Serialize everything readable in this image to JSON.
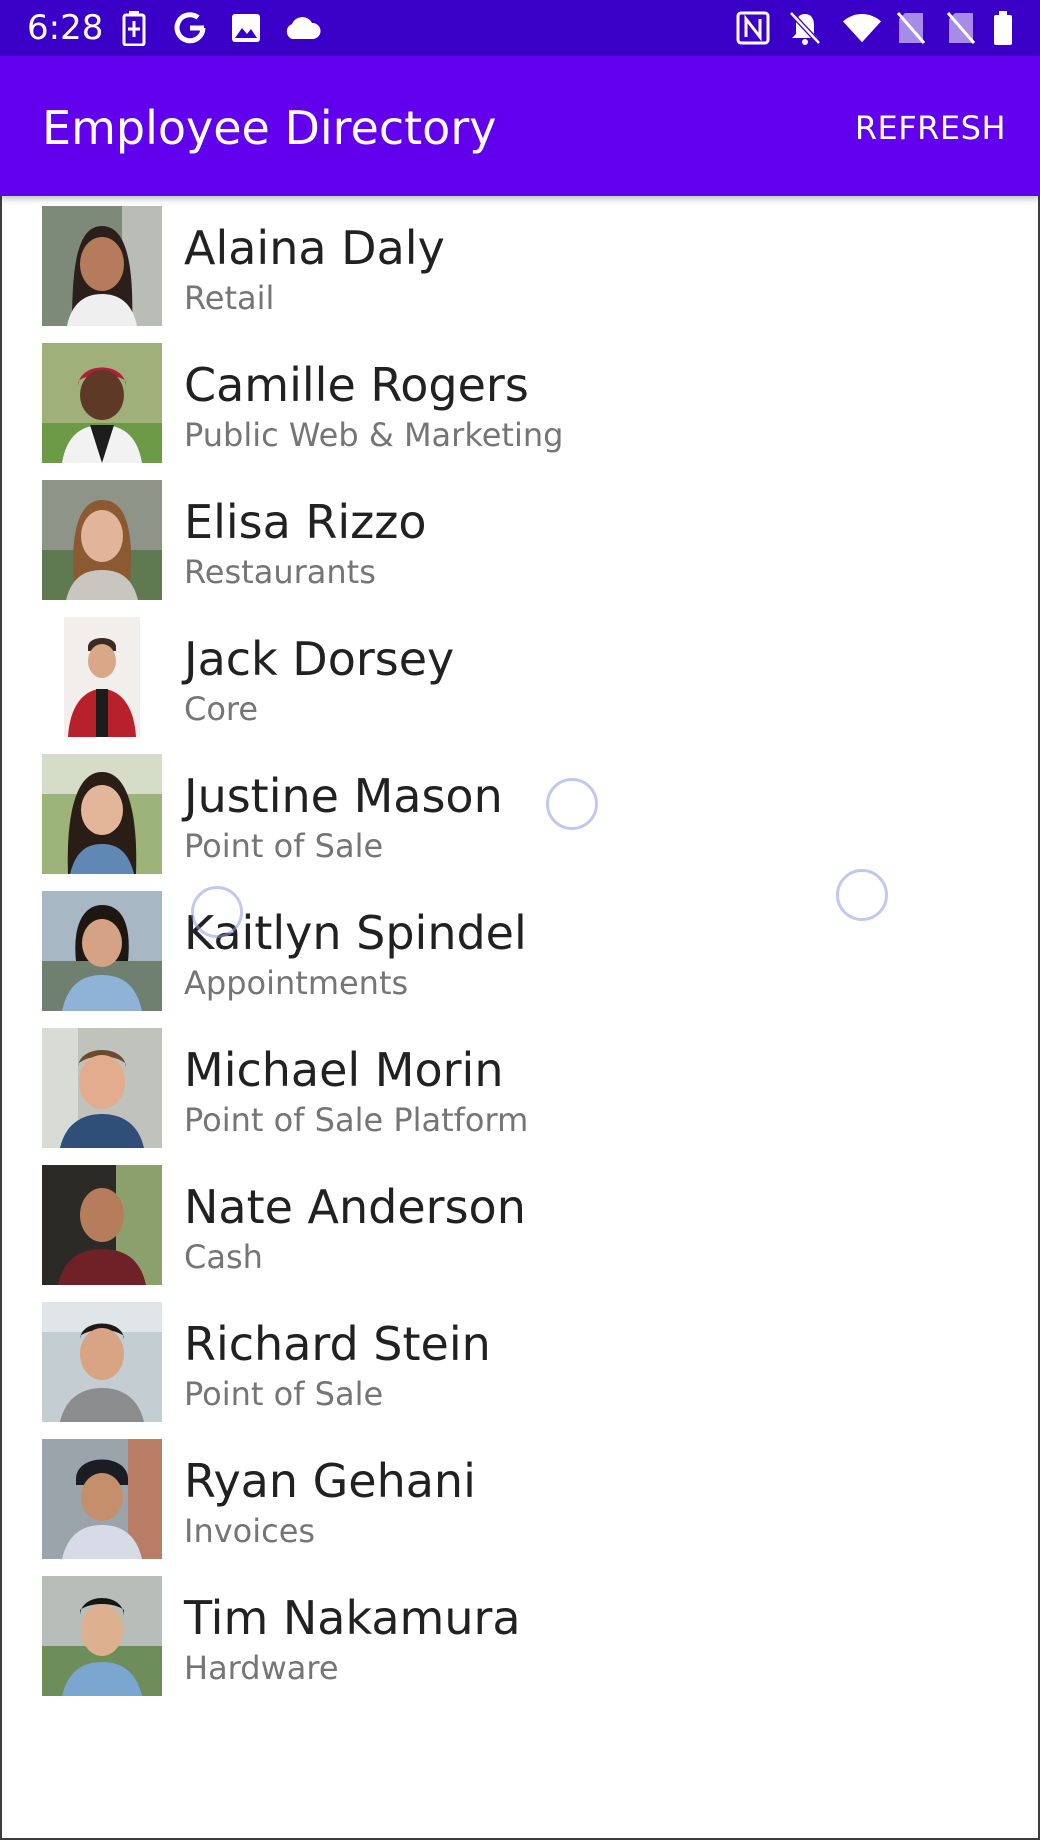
{
  "status_bar": {
    "time": "6:28",
    "left_icons": [
      "battery-charging-icon",
      "google-icon",
      "image-icon",
      "cloud-icon"
    ],
    "right_icons": [
      "nfc-icon",
      "notifications-off-icon",
      "wifi-icon",
      "no-sim-icon",
      "no-sim-icon",
      "battery-icon"
    ],
    "background": "#3a00c8"
  },
  "app_bar": {
    "title": "Employee Directory",
    "refresh_label": "REFRESH",
    "background": "#6200ee"
  },
  "employees": [
    {
      "name": "Alaina Daly",
      "team": "Retail"
    },
    {
      "name": "Camille Rogers",
      "team": "Public Web & Marketing"
    },
    {
      "name": "Elisa Rizzo",
      "team": "Restaurants"
    },
    {
      "name": "Jack Dorsey",
      "team": "Core"
    },
    {
      "name": "Justine Mason",
      "team": "Point of Sale"
    },
    {
      "name": "Kaitlyn Spindel",
      "team": "Appointments"
    },
    {
      "name": "Michael Morin",
      "team": "Point of Sale Platform"
    },
    {
      "name": "Nate Anderson",
      "team": "Cash"
    },
    {
      "name": "Richard Stein",
      "team": "Point of Sale"
    },
    {
      "name": "Ryan Gehani",
      "team": "Invoices"
    },
    {
      "name": "Tim Nakamura",
      "team": "Hardware"
    }
  ]
}
